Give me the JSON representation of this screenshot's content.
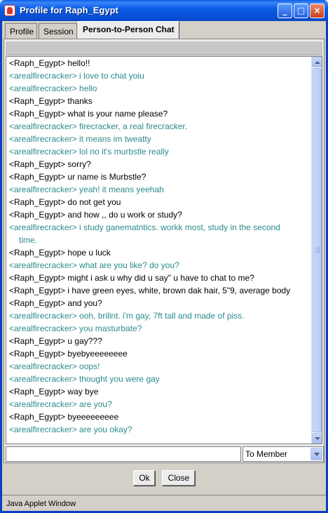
{
  "window": {
    "title": "Profile for Raph_Egypt"
  },
  "tabs": [
    {
      "label": "Profile"
    },
    {
      "label": "Session"
    },
    {
      "label": "Person-to-Person Chat"
    }
  ],
  "chat": {
    "lines": [
      {
        "who": "me",
        "text": "<Raph_Egypt> hello!!"
      },
      {
        "who": "other",
        "text": "<arealfirecracker> i love to chat yoiu"
      },
      {
        "who": "other",
        "text": "<arealfirecracker> hello"
      },
      {
        "who": "me",
        "text": "<Raph_Egypt> thanks"
      },
      {
        "who": "me",
        "text": "<Raph_Egypt> what is your name please?"
      },
      {
        "who": "other",
        "text": "<arealfirecracker> firecracker, a real firecracker."
      },
      {
        "who": "other",
        "text": "<arealfirecracker> it means im tweatty"
      },
      {
        "who": "other",
        "text": "<arealfirecracker> lol no it's murbstle really"
      },
      {
        "who": "me",
        "text": "<Raph_Egypt> sorry?"
      },
      {
        "who": "me",
        "text": "<Raph_Egypt> ur name is Murbstle?"
      },
      {
        "who": "other",
        "text": "<arealfirecracker> yeah! it means yeehah"
      },
      {
        "who": "me",
        "text": "<Raph_Egypt> do not get you"
      },
      {
        "who": "me",
        "text": "<Raph_Egypt> and how ,, do u work or study?"
      },
      {
        "who": "other",
        "text": "<arealfirecracker> i study ganematntics. workk most, study in the second",
        "cont": "time."
      },
      {
        "who": "me",
        "text": "<Raph_Egypt> hope u luck"
      },
      {
        "who": "other",
        "text": "<arealfirecracker> what are you like? do you?"
      },
      {
        "who": "me",
        "text": "<Raph_Egypt> might i ask u why did u say\" u have to chat to me?"
      },
      {
        "who": "me",
        "text": "<Raph_Egypt> i have green eyes, white, brown dak hair, 5\"9, average body"
      },
      {
        "who": "me",
        "text": "<Raph_Egypt> and you?"
      },
      {
        "who": "other",
        "text": "<arealfirecracker> ooh, brillnt. i'm gay, 7ft tall and made of piss."
      },
      {
        "who": "other",
        "text": "<arealfirecracker> you masturbate?"
      },
      {
        "who": "me",
        "text": "<Raph_Egypt> u gay???"
      },
      {
        "who": "me",
        "text": "<Raph_Egypt> byebyeeeeeeee"
      },
      {
        "who": "other",
        "text": "<arealfirecracker> oops!"
      },
      {
        "who": "other",
        "text": "<arealfirecracker> thought you were gay"
      },
      {
        "who": "me",
        "text": "<Raph_Egypt> way bye"
      },
      {
        "who": "other",
        "text": "<arealfirecracker> are you?"
      },
      {
        "who": "me",
        "text": "<Raph_Egypt> byeeeeeeeee"
      },
      {
        "who": "other",
        "text": "<arealfirecracker> are you okay?"
      }
    ]
  },
  "input": {
    "value": "",
    "recipient": "To Member"
  },
  "buttons": {
    "ok": "Ok",
    "close": "Close"
  },
  "status": {
    "text": "Java Applet Window"
  },
  "colors": {
    "my_text": "#000000",
    "other_text": "#2b8a8a",
    "titlebar": "#0a5ce6"
  },
  "icons": {
    "app": "applet-icon",
    "minimize": "minimize-icon",
    "maximize": "maximize-icon",
    "close": "close-icon"
  }
}
